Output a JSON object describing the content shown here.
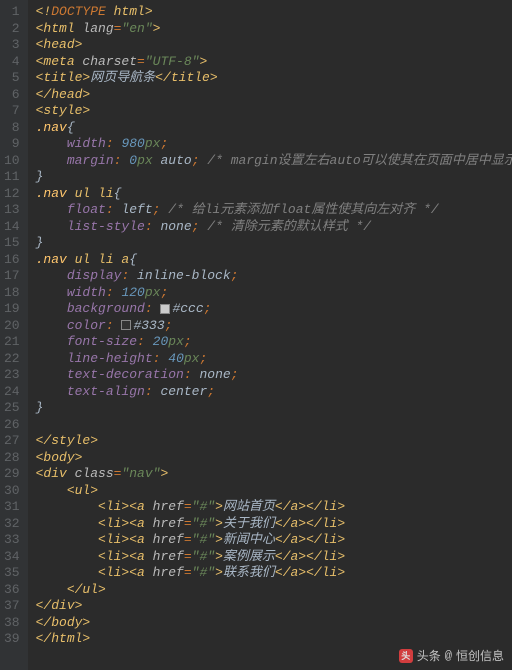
{
  "lines": {
    "l1": {
      "before": "<!",
      "kw": "DOCTYPE",
      "after": " html>"
    },
    "l2": {
      "t1": "<html ",
      "attr": "lang",
      "eq": "=",
      "val": "\"en\"",
      "t2": ">"
    },
    "l3": {
      "t": "<head>"
    },
    "l4": {
      "t1": "<meta ",
      "attr": "charset",
      "eq": "=",
      "val": "\"UTF-8\"",
      "t2": ">"
    },
    "l5": {
      "open": "<title>",
      "text": "网页导航条",
      "close": "</title>"
    },
    "l6": {
      "t": "</head>"
    },
    "l7": {
      "t": "<style>"
    },
    "l8": {
      "sel": ".nav",
      "brace": "{"
    },
    "l9": {
      "prop": "width",
      "colon": ": ",
      "num": "980",
      "unit": "px",
      "semi": ";"
    },
    "l10": {
      "prop": "margin",
      "colon": ": ",
      "num": "0",
      "unit": "px",
      "val2": " auto",
      "semi": ";",
      "comment": " /* margin设置左右auto可以使其在页面中居中显示 */"
    },
    "l11": {
      "brace": "}"
    },
    "l12": {
      "sel1": ".nav ",
      "sel2": "ul li",
      "brace": "{"
    },
    "l13": {
      "prop": "float",
      "colon": ": ",
      "val": "left",
      "semi": ";",
      "comment": " /* 给li元素添加float属性使其向左对齐 */"
    },
    "l14": {
      "prop": "list-style",
      "colon": ": ",
      "val": "none",
      "semi": ";",
      "comment": " /* 清除元素的默认样式 */"
    },
    "l15": {
      "brace": "}"
    },
    "l16": {
      "sel1": ".nav ",
      "sel2": "ul li a",
      "brace": "{"
    },
    "l17": {
      "prop": "display",
      "colon": ": ",
      "val": "inline-block",
      "semi": ";"
    },
    "l18": {
      "prop": "width",
      "colon": ": ",
      "num": "120",
      "unit": "px",
      "semi": ";"
    },
    "l19": {
      "prop": "background",
      "colon": ": ",
      "color": "#ccc",
      "semi": ";"
    },
    "l20": {
      "prop": "color",
      "colon": ": ",
      "color": "#333",
      "semi": ";"
    },
    "l21": {
      "prop": "font-size",
      "colon": ": ",
      "num": "20",
      "unit": "px",
      "semi": ";"
    },
    "l22": {
      "prop": "line-height",
      "colon": ": ",
      "num": "40",
      "unit": "px",
      "semi": ";"
    },
    "l23": {
      "prop": "text-decoration",
      "colon": ": ",
      "val": "none",
      "semi": ";"
    },
    "l24": {
      "prop": "text-align",
      "colon": ": ",
      "val": "center",
      "semi": ";"
    },
    "l25": {
      "brace": "}"
    },
    "l27": {
      "t": "</style>"
    },
    "l28": {
      "t": "<body>"
    },
    "l29": {
      "t1": "<div ",
      "attr": "class",
      "eq": "=",
      "val": "\"nav\"",
      "t2": ">"
    },
    "l30": {
      "t": "<ul>"
    },
    "li_open1": "<li><a ",
    "li_attr": "href",
    "li_eq": "=",
    "li_val": "\"#\"",
    "li_open2": ">",
    "li_close": "</a></li>",
    "li_texts": {
      "l31": "网站首页",
      "l32": "关于我们",
      "l33": "新闻中心",
      "l34": "案例展示",
      "l35": "联系我们"
    },
    "l36": {
      "t": "</ul>"
    },
    "l37": {
      "t": "</div>"
    },
    "l38": {
      "t": "</body>"
    },
    "l39": {
      "t": "</html>"
    }
  },
  "watermark": {
    "prefix": "头条",
    "at": "@",
    "name": "恒创信息"
  },
  "line_count": 39
}
